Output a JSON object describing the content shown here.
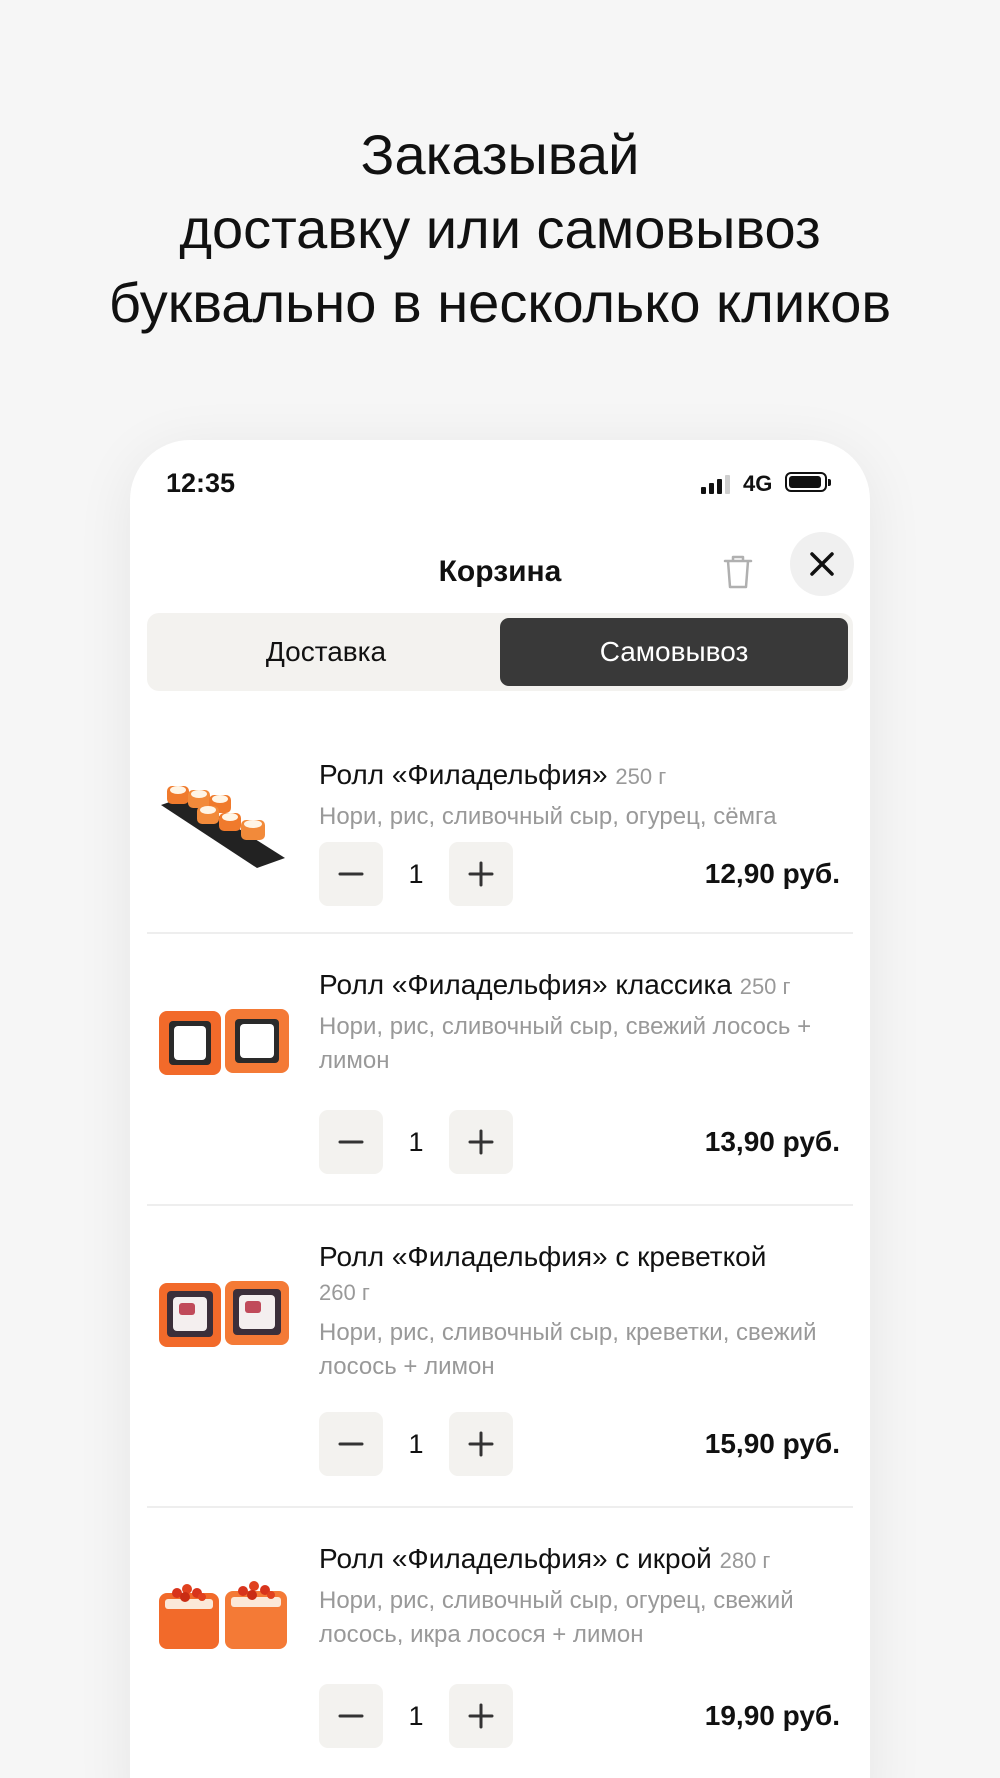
{
  "headline": [
    "Заказывай",
    "доставку или самовывоз",
    "буквально в несколько кликов"
  ],
  "status_bar": {
    "time": "12:35",
    "network": "4G"
  },
  "header": {
    "title": "Корзина",
    "trash_icon": "trash-icon",
    "close_icon": "close-icon"
  },
  "tabs": [
    {
      "label": "Доставка",
      "selected": false
    },
    {
      "label": "Самовывоз",
      "selected": true
    }
  ],
  "cart": {
    "items": [
      {
        "name": "Ролл «Филадельфия»",
        "weight": "250 г",
        "description": "Нори, рис, сливочный сыр, огурец, сёмга",
        "quantity": "1",
        "price": "12,90 руб."
      },
      {
        "name": "Ролл «Филадельфия» классика",
        "weight": "250 г",
        "description": "Нори, рис, сливочный сыр, свежий лосось + лимон",
        "quantity": "1",
        "price": "13,90 руб."
      },
      {
        "name": "Ролл «Филадельфия» с креветкой",
        "weight": "260 г",
        "description": "Нори, рис, сливочный сыр, креветки, свежий лосось + лимон",
        "quantity": "1",
        "price": "15,90 руб."
      },
      {
        "name": "Ролл «Филадельфия» с икрой",
        "weight": "280 г",
        "description": "Нори, рис, сливочный сыр, огурец, свежий лосось, икра лосося + лимон",
        "quantity": "1",
        "price": "19,90 руб."
      }
    ]
  },
  "colors": {
    "active_tab": "#393939",
    "control_bg": "#f3f2ef",
    "muted_text": "#999999"
  }
}
